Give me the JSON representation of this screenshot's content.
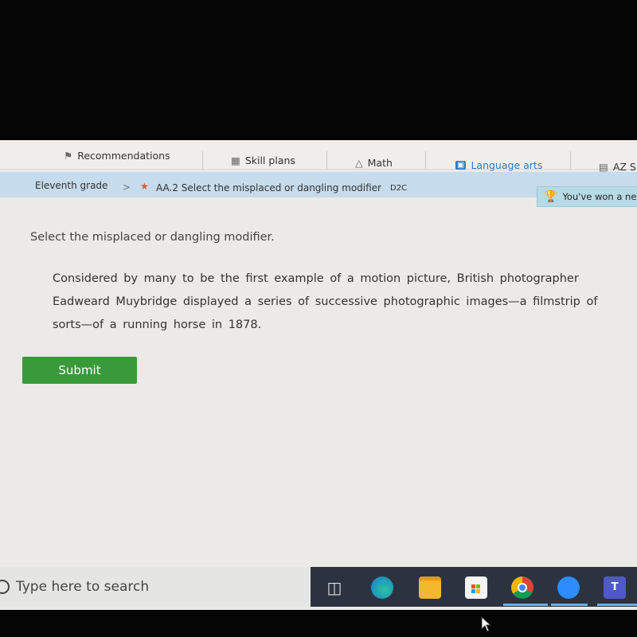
{
  "nav_tabs": [
    {
      "label": "Recommendations",
      "icon": "signpost-icon",
      "active": false
    },
    {
      "label": "Skill plans",
      "icon": "clipboard-icon",
      "active": false
    },
    {
      "label": "Math",
      "icon": "pyramid-icon",
      "active": false
    },
    {
      "label": "Language arts",
      "icon": "book-icon",
      "active": true
    },
    {
      "label": "AZ S",
      "icon": "clipboard-list-icon",
      "active": false
    }
  ],
  "breadcrumb": {
    "grade": "Eleventh grade",
    "separator": ">",
    "skill": "AA.2 Select the misplaced or dangling modifier",
    "code": "D2C"
  },
  "award_banner": "You've won a ne",
  "question": {
    "prompt": "Select the misplaced or dangling modifier.",
    "passage": "Considered by many to be the first example of a motion picture, British photographer Eadweard Muybridge displayed a series of successive photographic images—a filmstrip of sorts—of a running horse in 1878.",
    "submit_label": "Submit"
  },
  "colors": {
    "accent": "#2a7cc7",
    "submit": "#3a9a3a",
    "crumb_bg": "#c6dbeb"
  },
  "taskbar": {
    "search_placeholder": "Type here to search",
    "apps": [
      "task-view",
      "edge",
      "file-explorer",
      "microsoft-store",
      "chrome",
      "zoom",
      "teams"
    ]
  }
}
